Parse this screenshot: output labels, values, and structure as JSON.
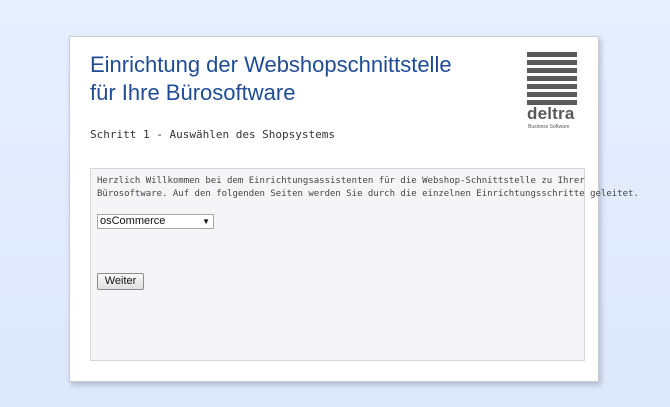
{
  "header": {
    "title_line1": "Einrichtung der Webshopschnittstelle",
    "title_line2": "für Ihre Bürosoftware",
    "step": "Schritt 1 - Auswählen des Shopsystems"
  },
  "logo": {
    "name": "deltra",
    "tagline": "Business Software"
  },
  "panel": {
    "intro_line1": "Herzlich Willkommen bei dem Einrichtungsassistenten für die Webshop-Schnittstelle zu Ihrer",
    "intro_line2": "Bürosoftware. Auf den folgenden Seiten werden Sie durch die einzelnen Einrichtungsschritte geleitet.",
    "shop_select": {
      "value": "osCommerce"
    },
    "next_button_label": "Weiter"
  },
  "colors": {
    "background": "#e6efff",
    "title": "#1f4c95",
    "logo_gray": "#595959"
  }
}
